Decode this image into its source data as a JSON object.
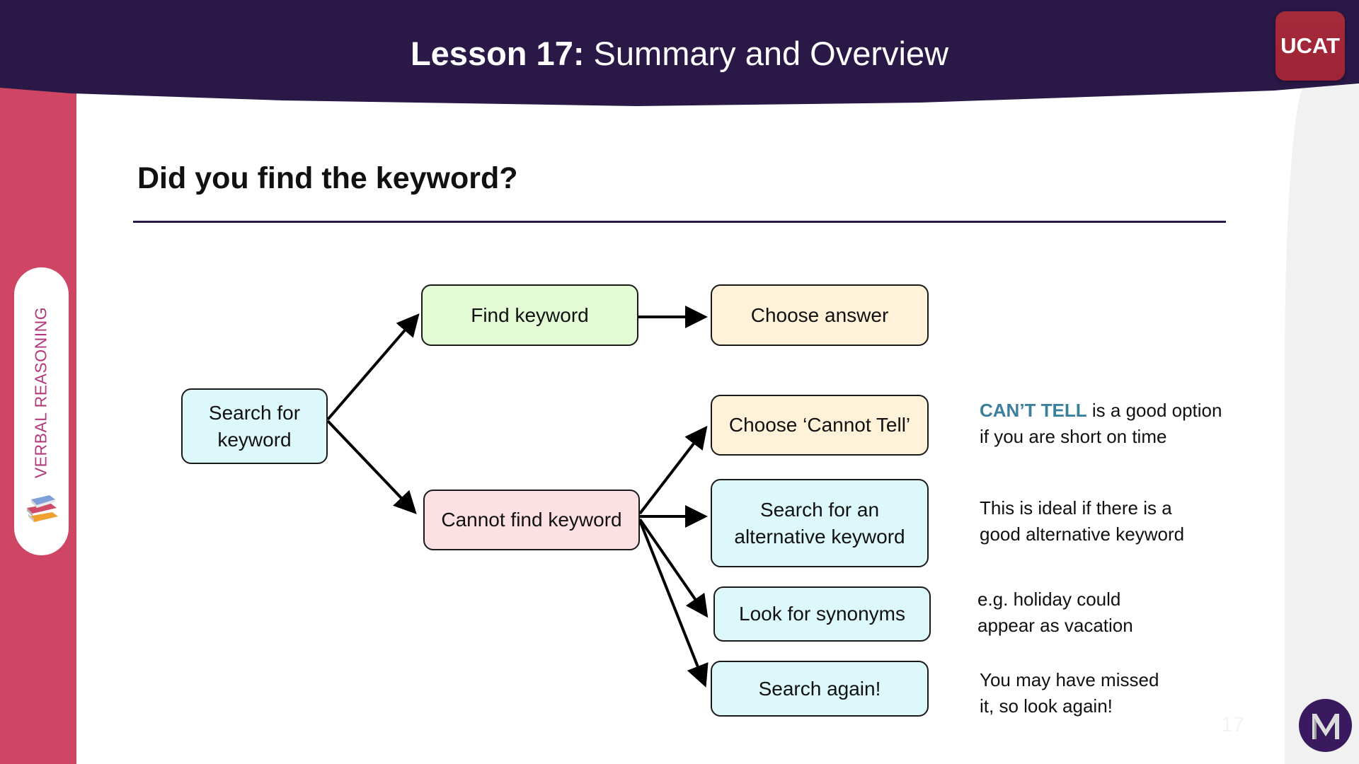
{
  "header": {
    "title_bold": "Lesson 17:",
    "title_regular": " Summary and Overview",
    "badge": "UCAT"
  },
  "sidebar": {
    "section_label": "VERBAL REASONING",
    "icon": "books-icon"
  },
  "slide": {
    "title": "Did you find the keyword?",
    "page_number": "17"
  },
  "diagram": {
    "nodes": {
      "search": "Search for keyword",
      "find": "Find keyword",
      "choose_answer": "Choose answer",
      "cannot_find": "Cannot find keyword",
      "choose_cannot_tell": "Choose ‘Cannot Tell’",
      "alt_keyword": "Search for an alternative keyword",
      "synonyms": "Look for synonyms",
      "search_again": "Search again!"
    },
    "edges": [
      {
        "from": "search",
        "to": "find"
      },
      {
        "from": "search",
        "to": "cannot_find"
      },
      {
        "from": "find",
        "to": "choose_answer"
      },
      {
        "from": "cannot_find",
        "to": "choose_cannot_tell"
      },
      {
        "from": "cannot_find",
        "to": "alt_keyword"
      },
      {
        "from": "cannot_find",
        "to": "synonyms"
      },
      {
        "from": "cannot_find",
        "to": "search_again"
      }
    ],
    "colors": {
      "blue": "#dcf8fb",
      "green": "#e2fbd4",
      "cream": "#fff2d8",
      "pink": "#fde0e3"
    }
  },
  "notes": {
    "cant_tell_highlight": "CAN’T TELL",
    "cant_tell_rest_line1": " is a good option",
    "cant_tell_line2": "if you are short on time",
    "alt_line1": "This is ideal if there is a",
    "alt_line2": "good alternative keyword",
    "syn_line1": "e.g. holiday could",
    "syn_line2": "appear as vacation",
    "again_line1": "You may have missed",
    "again_line2": "it, so look again!"
  },
  "colors": {
    "header_bg": "#2a1846",
    "sidebar_bg": "#cf4564",
    "badge_bg": "#a52a3a",
    "highlight_text": "#3c7f9c",
    "section_label": "#b5387a"
  }
}
